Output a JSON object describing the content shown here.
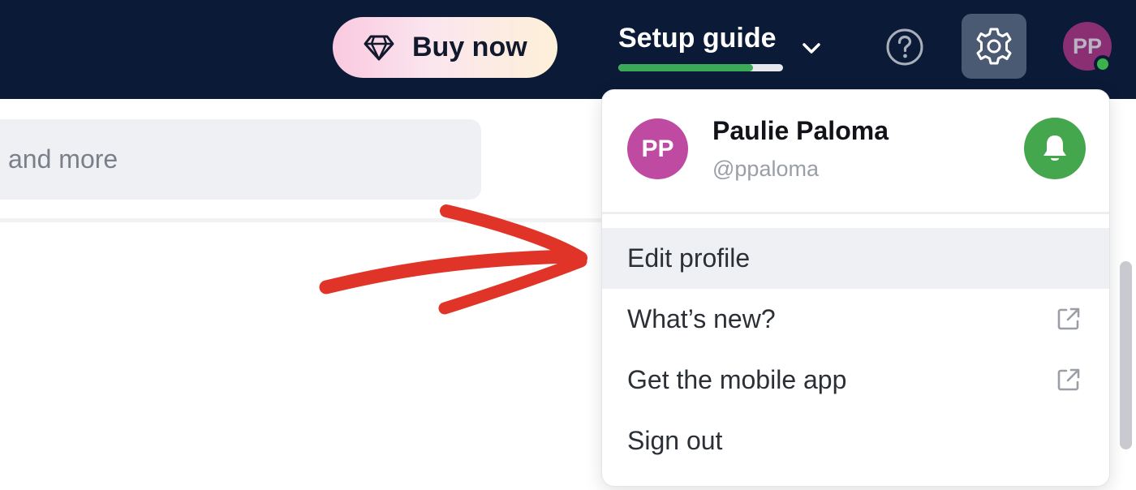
{
  "header": {
    "buy_label": "Buy now",
    "setup_label": "Setup guide",
    "setup_progress": 0.82,
    "avatar_initials": "PP"
  },
  "search": {
    "visible_text": "and more"
  },
  "menu": {
    "avatar_initials": "PP",
    "user_name": "Paulie Paloma",
    "user_handle": "@ppaloma",
    "items": [
      {
        "label": "Edit profile"
      },
      {
        "label": "What’s new?"
      },
      {
        "label": "Get the mobile app"
      },
      {
        "label": "Sign out"
      }
    ]
  },
  "colors": {
    "topbar": "#0b1a36",
    "progress": "#3aaa57",
    "avatar": "#be4aa1",
    "bell": "#44a64d",
    "arrow": "#e03428"
  },
  "icons": [
    "diamond-icon",
    "chevron-down-icon",
    "help-icon",
    "gear-icon",
    "bell-icon",
    "external-link-icon",
    "annotation-arrow"
  ]
}
